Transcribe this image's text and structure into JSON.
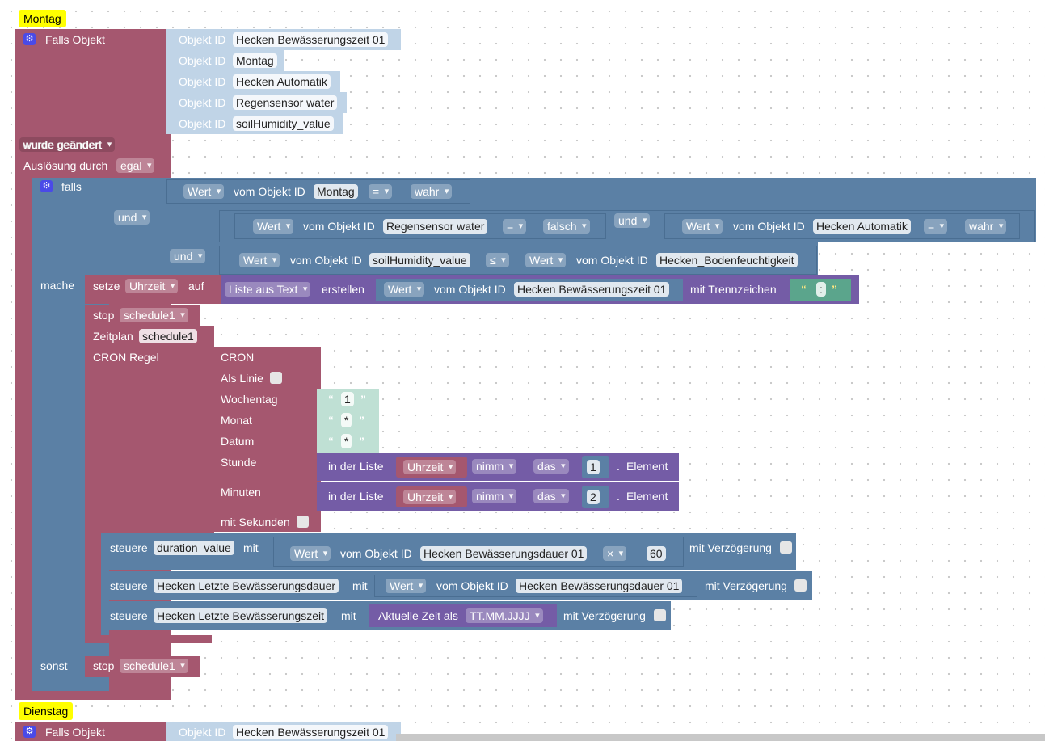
{
  "comments": {
    "c1": "Montag",
    "c2": "Dienstag"
  },
  "trigger": {
    "label": "Falls Objekt",
    "objekt_id_label": "Objekt ID",
    "objects": [
      "Hecken Bewässerungszeit 01",
      "Montag",
      "Hecken Automatik",
      "Regensensor water",
      "soilHumidity_value"
    ],
    "changed": "wurde geändert",
    "ausloesung": "Auslösung durch",
    "egal": "egal"
  },
  "trigger2": {
    "label": "Falls Objekt",
    "objekt_id_label": "Objekt ID",
    "first_object": "Hecken Bewässerungszeit 01"
  },
  "if_block": {
    "falls": "falls",
    "und": "und",
    "mache": "mache",
    "sonst": "sonst",
    "wert": "Wert",
    "vom_objekt_id": "vom Objekt ID",
    "c1_obj": "Montag",
    "c1_op": "=",
    "c1_val": "wahr",
    "c2_obj": "Regensensor water",
    "c2_op": "=",
    "c2_val": "falsch",
    "c3_obj": "Hecken Automatik",
    "c3_op": "=",
    "c3_val": "wahr",
    "c4_obj": "soilHumidity_value",
    "c4_op": "≤",
    "c4_obj2": "Hecken_Bodenfeuchtigkeit"
  },
  "setze": {
    "setze": "setze",
    "var": "Uhrzeit",
    "auf": "auf",
    "liste_aus_text": "Liste aus Text",
    "erstellen": "erstellen",
    "obj": "Hecken Bewässerungszeit 01",
    "mit_trennzeichen": "mit Trennzeichen",
    "sep": ":"
  },
  "stop1": {
    "label": "stop",
    "sched": "schedule1"
  },
  "zeitplan": {
    "label": "Zeitplan",
    "sched": "schedule1",
    "cron_regel": "CRON Regel"
  },
  "cron": {
    "title": "CRON",
    "als_linie": "Als Linie",
    "wochentag": "Wochentag",
    "wochentag_val": "1",
    "monat": "Monat",
    "monat_val": "*",
    "datum": "Datum",
    "datum_val": "*",
    "stunde": "Stunde",
    "minuten": "Minuten",
    "mit_sekunden": "mit Sekunden",
    "in_der_liste": "in der Liste",
    "var": "Uhrzeit",
    "nimm": "nimm",
    "das": "das",
    "idx1": "1",
    "idx2": "2",
    "element": "Element"
  },
  "steuere": {
    "steuere": "steuere",
    "mit": "mit",
    "mit_verzoegerung": "mit Verzögerung",
    "t1": "duration_value",
    "t1_obj": "Hecken Bewässerungsdauer 01",
    "op": "×",
    "num": "60",
    "t2": "Hecken Letzte Bewässerungsdauer",
    "t2_obj": "Hecken Bewässerungsdauer 01",
    "t3": "Hecken Letzte Bewässerungszeit",
    "aktuelle_zeit": "Aktuelle Zeit als",
    "format": "TT.MM.JJJJ"
  },
  "stop2": {
    "label": "stop",
    "sched": "schedule1"
  },
  "quote_open": "“",
  "quote_close": "”"
}
